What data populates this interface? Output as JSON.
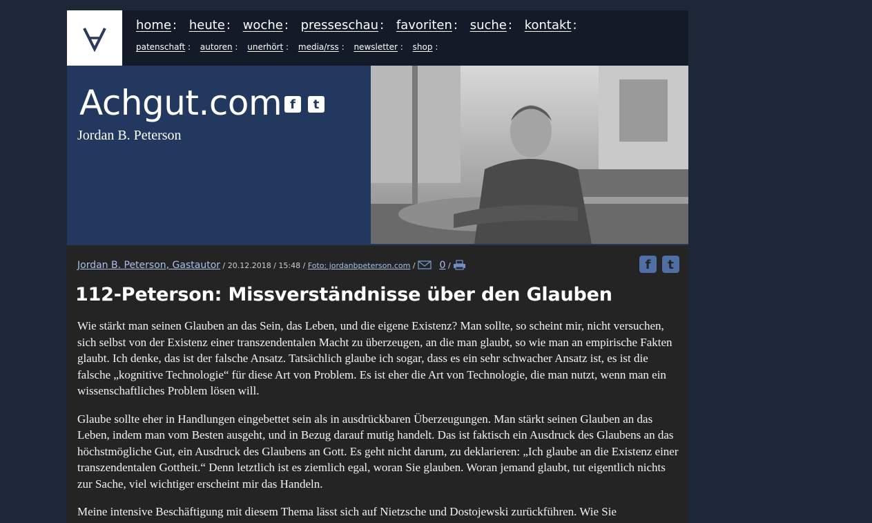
{
  "logo": {
    "symbol": "∀",
    "name": "achgut-logo"
  },
  "nav": {
    "main": [
      "home",
      "heute",
      "woche",
      "presseschau",
      "favoriten",
      "suche",
      "kontakt"
    ],
    "sub": [
      "patenschaft",
      "autoren",
      "unerhört",
      "media/rss",
      "newsletter",
      "shop"
    ],
    "separator": ":"
  },
  "hero": {
    "site_title": "Achgut.com",
    "subtitle": "Jordan B. Peterson",
    "social": {
      "facebook": "f",
      "twitter": "t"
    }
  },
  "article": {
    "author": "Jordan B. Peterson, Gastautor",
    "date": "20.12.2018",
    "time": "15:48",
    "photo_credit": "Foto: jordanbpeterson.com",
    "comment_count": "0",
    "title": "112-Peterson: Missverständnisse über den Glauben",
    "paragraphs": [
      "Wie stärkt man seinen Glauben an das Sein, das Leben, und die eigene Existenz? Man sollte, so scheint mir, nicht versuchen, sich selbst von der Existenz einer transzendentalen Macht zu überzeugen, an die man glaubt, so wie man an empirische Fakten glaubt. Ich denke, das ist der falsche Ansatz. Tatsächlich glaube ich sogar, dass es ein sehr schwacher Ansatz ist, es ist die falsche „kognitive Technologie“ für diese Art von Problem. Es ist eher die Art von Technologie, die man nutzt, wenn man ein wissenschaftliches Problem lösen will.",
      "Glaube sollte eher in Handlungen eingebettet sein als in ausdrückbaren Überzeugungen. Man stärkt seinen Glauben an das Leben, indem man vom Besten ausgeht, und in Bezug darauf mutig handelt. Das ist faktisch ein Ausdruck des Glaubens an das höchstmögliche Gut, ein Ausdruck des Glaubens an Gott. Es geht nicht darum, zu deklarieren: „Ich glaube an die Existenz einer transzendentalen Gottheit.“ Denn letztlich ist es ziemlich egal, woran Sie glauben. Woran jemand glaubt, tut eigentlich nichts zur Sache, viel wichtiger erscheint mir das Handeln.",
      "Meine intensive Beschäftigung mit diesem Thema lässt sich auf Nietzsche und Dostojewski zurückführen. Wie Sie"
    ]
  },
  "colors": {
    "page_bg": "#1d2737",
    "header_bg": "#131b29",
    "hero_bg": "#23385e",
    "article_bg": "#242424",
    "link": "#a9c1e8",
    "social_button": "#4f6fa6"
  }
}
